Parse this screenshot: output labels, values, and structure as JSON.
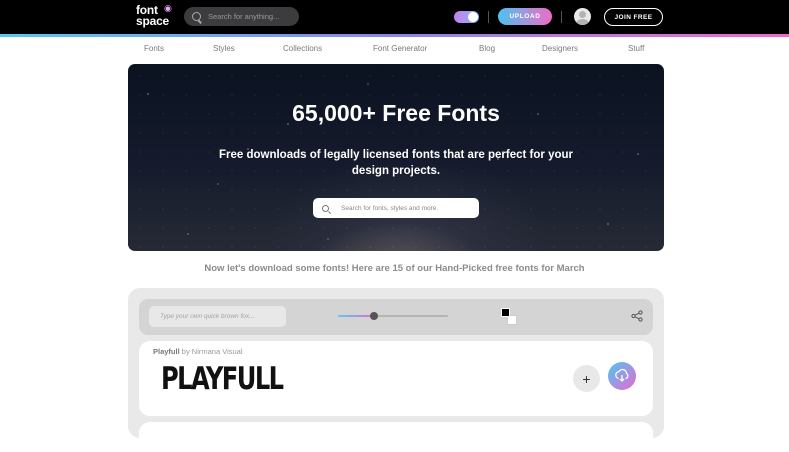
{
  "header": {
    "logo_line1": "font",
    "logo_line2": "space",
    "search_placeholder": "Search for anything...",
    "upload_label": "UPLOAD",
    "join_label": "JOIN FREE"
  },
  "nav": {
    "items": [
      "Fonts",
      "Styles",
      "Collections",
      "Font Generator",
      "Blog",
      "Designers",
      "Stuff"
    ]
  },
  "hero": {
    "title": "65,000+ Free Fonts",
    "subtitle": "Free downloads of legally licensed fonts that are perfect for your design projects.",
    "search_placeholder": "Search for fonts, styles and more."
  },
  "intro_text": "Now let's download some fonts! Here are 15 of our Hand-Picked free fonts for March",
  "toolbar": {
    "preview_placeholder": "Type your own quick brown fox...",
    "size_level": 0.33,
    "text_color": "#000000",
    "background_color": "#ffffff"
  },
  "fonts": [
    {
      "name": "Playfull",
      "by_label": "by",
      "designer": "Nirmana Visual",
      "sample": "PLAYFULL"
    },
    {
      "name": "",
      "by_label": "",
      "designer": ""
    }
  ],
  "colors": {
    "accent_blue": "#4fc6f2",
    "accent_pink": "#e869d0",
    "topbar": "#000000"
  },
  "icons": {
    "search": "search-icon",
    "theme_toggle": "theme-toggle-icon",
    "avatar": "user-avatar-icon",
    "share": "share-icon",
    "add": "plus-icon",
    "download": "download-icon"
  }
}
